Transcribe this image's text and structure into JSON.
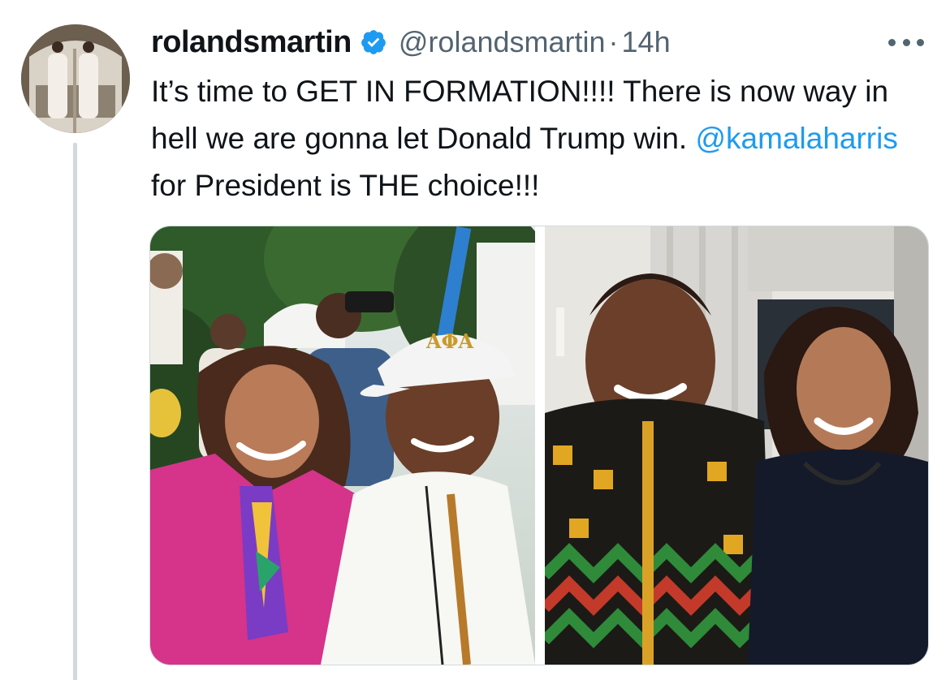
{
  "tweet": {
    "display_name": "rolandsmartin",
    "handle": "@rolandsmartin",
    "separator": "·",
    "timestamp": "14h",
    "text_before_mention": "It’s time to GET IN FORMATION!!!! There is now way in hell we are gonna let Donald Trump win. ",
    "mention": "@kamalaharris",
    "text_after_mention": " for President is THE choice!!!",
    "photos": [
      {
        "subject": "selfie-outdoors",
        "cap_text": "ΑΦΑ"
      },
      {
        "subject": "portrait-indoors"
      }
    ]
  },
  "icons": {
    "verified": "verified-badge-icon",
    "more": "more-options-icon"
  },
  "colors": {
    "accent": "#1d9bf0",
    "text_primary": "#0f1419",
    "text_secondary": "#536471",
    "thread_line": "#cfd9de",
    "blazer_pink": "#d6338a"
  }
}
